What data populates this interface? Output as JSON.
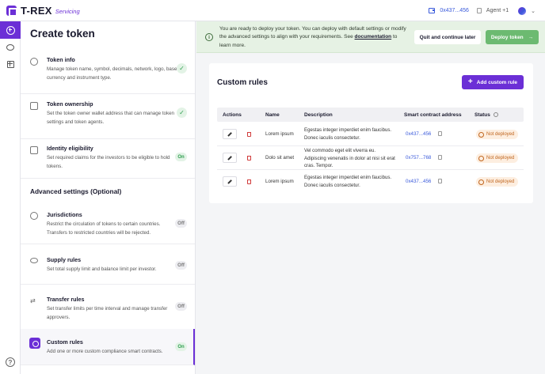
{
  "app": {
    "name": "T-REX",
    "sub": "Servicing"
  },
  "header": {
    "wallet_address": "0x437...456",
    "agent_label": "Agent +1"
  },
  "panel": {
    "title": "Create token",
    "steps": [
      {
        "title": "Token info",
        "desc": "Manage token name, symbol, decimals, network, logo, base currency and instrument type.",
        "state": "✓"
      },
      {
        "title": "Token ownership",
        "desc": "Set the token owner wallet address that can manage token settings and token agents.",
        "state": "✓"
      },
      {
        "title": "Identity eligibility",
        "desc": "Set required claims for the investors to be eligible to hold tokens.",
        "state": "On"
      }
    ],
    "advanced_title": "Advanced settings (Optional)",
    "advanced": [
      {
        "title": "Jurisdictions",
        "desc": "Restrict the circulation of tokens to certain countries. Transfers to restricted countries will be rejected.",
        "state": "Off"
      },
      {
        "title": "Supply rules",
        "desc": "Set total supply limit and balance limit per investor.",
        "state": "Off"
      },
      {
        "title": "Transfer rules",
        "desc": "Set transfer limits per time interval and manage transfer approvers.",
        "state": "Off"
      },
      {
        "title": "Custom rules",
        "desc": "Add one or more custom compliance smart contracts.",
        "state": "On"
      }
    ]
  },
  "banner": {
    "text_before": "You are ready to deploy your token. You can deploy with default settings or modify the advanced settings to align with your requirements. See ",
    "link": "documentation",
    "text_after": " to learn more.",
    "quit_label": "Quit and continue later",
    "deploy_label": "Deploy token"
  },
  "main": {
    "title": "Custom rules",
    "add_label": "Add custom rule",
    "columns": [
      "Actions",
      "Name",
      "Description",
      "Smart contract address",
      "Status"
    ],
    "rows": [
      {
        "name": "Lorem ipsum",
        "desc": "Egestas integer imperdiet enim faucibus. Donec iaculis consectetur.",
        "address": "0x437...456",
        "status": "Not deployed"
      },
      {
        "name": "Dolo sit amet",
        "desc": "Vel commodo eget elit viverra eu. Adipiscing venenatis in dolor at nisi sit erat cras. Tempor.",
        "address": "0x757...768",
        "status": "Not deployed"
      },
      {
        "name": "Lorem ipsum",
        "desc": "Egestas integer imperdiet enim faucibus. Donec iaculis consectetur.",
        "address": "0x437...456",
        "status": "Not deployed"
      }
    ]
  },
  "colors": {
    "brand": "#6b2fd6",
    "success": "#6cba71",
    "link": "#3b5bdb",
    "warning": "#c0651d"
  }
}
